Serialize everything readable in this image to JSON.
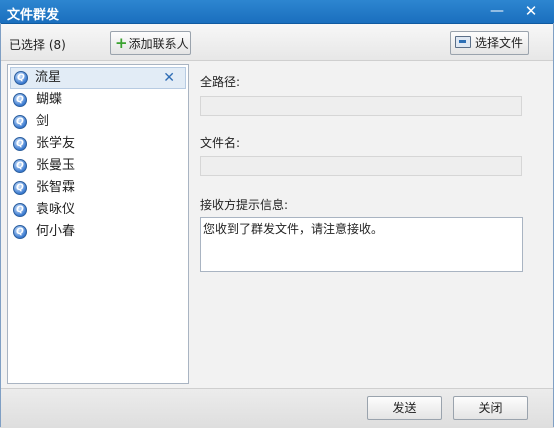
{
  "window": {
    "title": "文件群发",
    "minimize_glyph": "—",
    "close_glyph": "✕"
  },
  "toolbar": {
    "selected_label": "已选择 (8)",
    "add_contact_label": "添加联系人",
    "select_file_label": "选择文件"
  },
  "contacts": [
    {
      "name": "流星",
      "selected": true
    },
    {
      "name": "蝴蝶"
    },
    {
      "name": "剑"
    },
    {
      "name": "张学友"
    },
    {
      "name": "张曼玉"
    },
    {
      "name": "张智霖"
    },
    {
      "name": "袁咏仪"
    },
    {
      "name": "何小春"
    }
  ],
  "form": {
    "full_path_label": "全路径:",
    "full_path_value": "",
    "file_name_label": "文件名:",
    "file_name_value": "",
    "receiver_hint_label": "接收方提示信息:",
    "receiver_hint_value": "您收到了群发文件，请注意接收。"
  },
  "footer": {
    "send_label": "发送",
    "close_label": "关闭"
  },
  "icons": {
    "contact_icon": "qq-icon",
    "remove_icon": "close-icon",
    "add_icon": "plus-icon",
    "file_icon": "file-icon"
  },
  "colors": {
    "titlebar": "#1f78c7",
    "accent": "#2f6db5",
    "add_plus": "#3aa230"
  }
}
